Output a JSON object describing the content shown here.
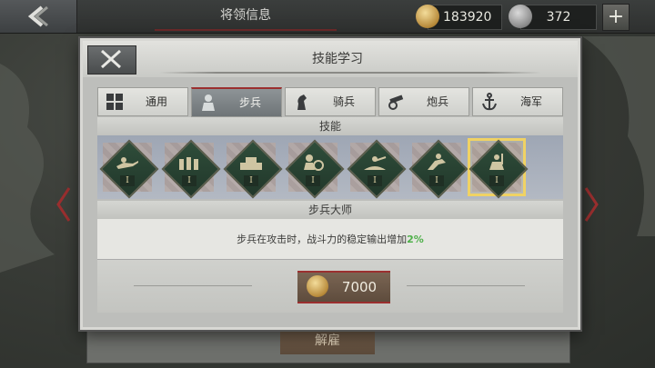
{
  "topbar": {
    "title": "将领信息",
    "gold_amount": "183920",
    "silver_amount": "372",
    "plus_icon": "plus"
  },
  "background": {
    "fire_button": "解雇"
  },
  "modal": {
    "title": "技能学习",
    "tabs": [
      {
        "label": "通用",
        "icon": "grid-icon",
        "active": false
      },
      {
        "label": "步兵",
        "icon": "infantry-icon",
        "active": true
      },
      {
        "label": "骑兵",
        "icon": "knight-icon",
        "active": false
      },
      {
        "label": "炮兵",
        "icon": "cannon-icon",
        "active": false
      },
      {
        "label": "海军",
        "icon": "anchor-icon",
        "active": false
      }
    ],
    "skills_heading": "技能",
    "skills": [
      {
        "level": "I",
        "icon": "rifleman-prone-icon",
        "selected": false
      },
      {
        "level": "I",
        "icon": "infantry-line-icon",
        "selected": false
      },
      {
        "level": "I",
        "icon": "fortification-icon",
        "selected": false
      },
      {
        "level": "I",
        "icon": "shield-soldier-icon",
        "selected": false
      },
      {
        "level": "I",
        "icon": "trench-gunner-icon",
        "selected": false
      },
      {
        "level": "I",
        "icon": "charging-soldier-icon",
        "selected": false
      },
      {
        "level": "I",
        "icon": "infantry-master-icon",
        "selected": true
      }
    ],
    "skill_name": "步兵大师",
    "description_prefix": "步兵在攻击时，战斗力的稳定输出增加",
    "description_value": "2%",
    "cost": "7000",
    "colors": {
      "accent_red": "#9b2f2f",
      "selected_gold": "#f0d264",
      "bonus_green": "#4fb04a"
    }
  }
}
